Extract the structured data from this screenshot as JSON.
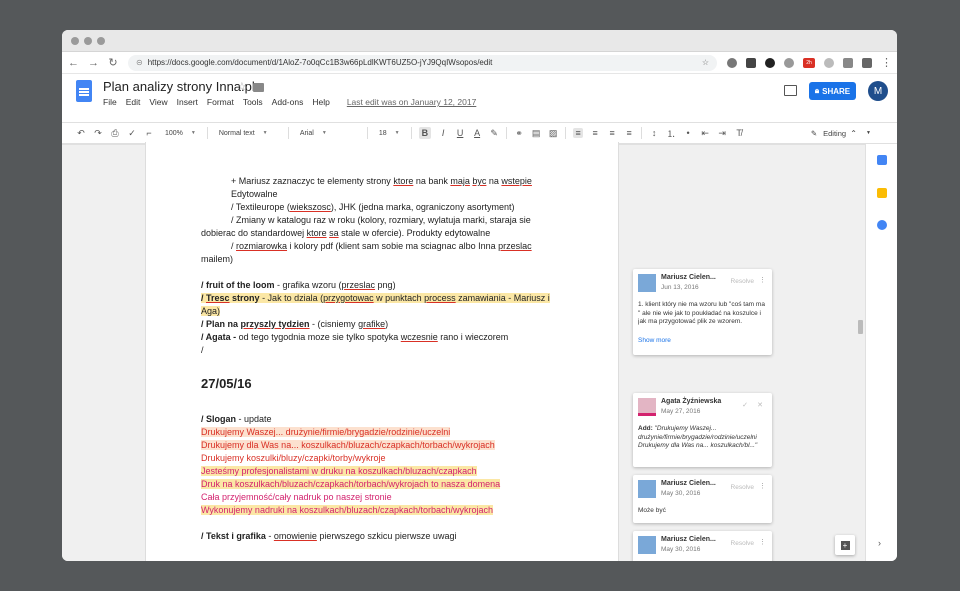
{
  "browser": {
    "url": "https://docs.google.com/document/d/1AloZ-7o0qCc1B3w66pLdlKWT6UZ5O-jYJ9QqIWsopos/edit",
    "badge": "2h"
  },
  "doc": {
    "title": "Plan analizy strony Inna.pl",
    "menu": [
      "File",
      "Edit",
      "View",
      "Insert",
      "Format",
      "Tools",
      "Add-ons",
      "Help"
    ],
    "last_edit": "Last edit was on January 12, 2017",
    "share_label": "SHARE",
    "avatar_letter": "M"
  },
  "toolbar": {
    "zoom": "100%",
    "style": "Normal text",
    "font": "Arial",
    "size": "18",
    "bold": "B",
    "italic": "I",
    "underline": "U",
    "text_color": "A",
    "mode": "Editing"
  },
  "content": {
    "l1_a": "+ Mariusz zaznaczyc te elementy strony ",
    "l1_b": "ktore",
    "l1_c": " na bank ",
    "l1_d": "maja",
    "l1_e": " ",
    "l1_f": "byc",
    "l1_g": " na ",
    "l1_h": "wstepie",
    "l1_i": "Edytowalne",
    "l2_a": "/ Textileurope (",
    "l2_b": "wiekszosc",
    "l2_c": "), JHK (jedna marka, ograniczony asortyment)",
    "l3_a": "/ Zmiany w katalogu raz w roku (kolory, rozmiary, wylatuja marki, staraja sie",
    "l3_b": "dobierac do standardowej ",
    "l3_c": "ktore",
    "l3_d": " ",
    "l3_e": "sa",
    "l3_f": " stale w ofercie).  Produkty edytowalne",
    "l4_a": "/  ",
    "l4_b": "rozmiarowka",
    "l4_c": " i kolory pdf (klient sam sobie ma sciagnac albo Inna ",
    "l4_d": "przeslac",
    "l4_e": "mailem)",
    "f1_a": "/ fruit of the loom",
    "f1_b": " - grafika wzoru (",
    "f1_c": "przeslac",
    "f1_d": " png)",
    "f2_a": "/ ",
    "f2_b": "Tresc",
    "f2_c": " strony",
    "f2_d": " - Jak to dziala (",
    "f2_e": "przygotowac",
    "f2_f": " w punktach ",
    "f2_g": "process",
    "f2_h": " zamawiania - Mariusz i",
    "f2_i": "Aga)",
    "f3_a": "/ Plan na ",
    "f3_b": "przyszly tydzien",
    "f3_c": " - (cisniemy ",
    "f3_d": "grafike",
    "f3_e": ")",
    "f4_a": "/ Agata -",
    "f4_b": " od tego tygodnia moze sie tylko spotyka ",
    "f4_c": "wczesnie",
    "f4_d": " rano i wieczorem",
    "f5": "/",
    "heading": "27/05/16",
    "slogan_a": "/ Slogan",
    "slogan_b": " - update",
    "s1": "Drukujemy Waszej... drużynie/firmie/brygadzie/rodzinie/uczelni",
    "s2": "Drukujemy dla Was na... koszulkach/bluzach/czapkach/torbach/wykrojach",
    "s3": "Drukujemy koszulki/bluzy/czapki/torby/wykroje",
    "s4": "Jesteśmy profesjonalistami w druku na koszulkach/bluzach/czapkach",
    "s5": "Druk na koszulkach/bluzach/czapkach/torbach/wykrojach to nasza domena",
    "s6": "Cała przyjemność/cały nadruk po naszej stronie",
    "s7": "Wykonujemy nadruki na koszulkach/bluzach/czapkach/torbach/wykrojach",
    "t1_a": "/ Tekst i grafika",
    "t1_b": " - ",
    "t1_c": "omowienie",
    "t1_d": " pierwszego szkicu pierwsze uwagi"
  },
  "comments": [
    {
      "name": "Mariusz Cielen...",
      "date": "Jun 13, 2016",
      "resolve": "Resolve",
      "body": "1. klient który nie ma wzoru lub \"coś tam ma \" ale nie wie jak to poukładać na koszulce i jak ma przygotować plik ze wzorem.",
      "show_more": "Show more"
    },
    {
      "name": "Agata Żyźniewska",
      "date": "May 27, 2016",
      "add_label": "Add:",
      "body": "\"Drukujemy Waszej... drużynie/firmie/brygadzie/rodzinie/uczelni Drukujemy dla Was na... koszulkach/bl...\""
    },
    {
      "name": "Mariusz Cielen...",
      "date": "May 30, 2016",
      "resolve": "Resolve",
      "body": "Może być"
    },
    {
      "name": "Mariusz Cielen...",
      "date": "May 30, 2016",
      "resolve": "Resolve"
    }
  ]
}
